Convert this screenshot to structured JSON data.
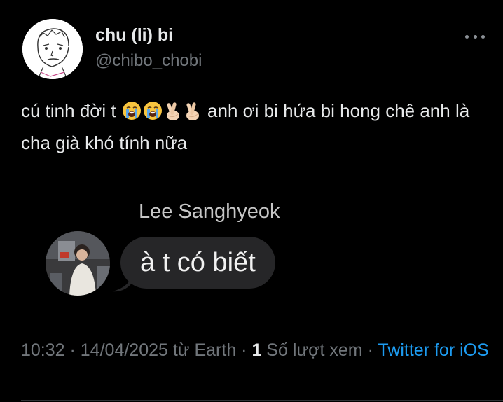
{
  "tweet": {
    "author": {
      "display_name": "chu (li) bi",
      "handle": "@chibo_chobi"
    },
    "text_before_emoji": "cú tinh đời t ",
    "emojis": [
      "loudly-crying-face",
      "loudly-crying-face",
      "hand-with-index-finger-and-thumb-crossed",
      "hand-with-index-finger-and-thumb-crossed"
    ],
    "text_after_emoji": " anh ơi bi hứa bi hong chê anh là cha già khó tính nữa",
    "media": {
      "sender_name": "Lee Sanghyeok",
      "message": "à t có biết"
    },
    "meta": {
      "time": "10:32",
      "separator": " · ",
      "date": "14/04/2025",
      "location": " từ Earth",
      "view_count": "1",
      "views_label": " Số lượt xem",
      "source": "Twitter for iOS"
    }
  },
  "colors": {
    "background": "#000000",
    "text_primary": "#e7e9ea",
    "text_secondary": "#71767b",
    "link": "#1d9bf0",
    "bubble": "#262628"
  }
}
